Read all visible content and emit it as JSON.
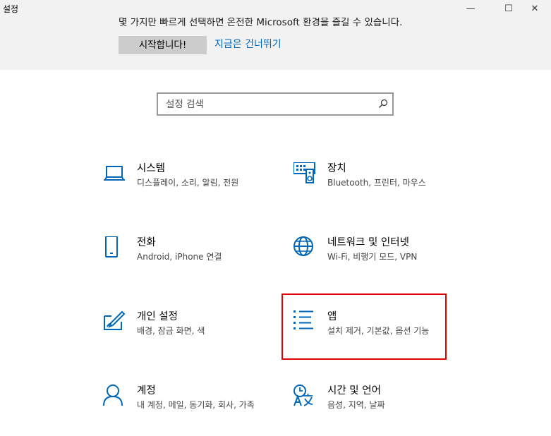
{
  "window": {
    "title": "설정",
    "minimize_glyph": "—",
    "maximize_glyph": "☐",
    "close_glyph": "✕"
  },
  "banner": {
    "text": "몇 가지만 빠르게 선택하면 온전한 Microsoft 환경을 즐길 수 있습니다.",
    "start_button": "시작합니다!",
    "skip_link": "지금은 건너뛰기"
  },
  "search": {
    "placeholder": "설정 검색"
  },
  "accent_color": "#0067b8",
  "highlight_color": "#e00000",
  "categories": [
    {
      "title": "시스템",
      "subtitle": "디스플레이, 소리, 알림, 전원",
      "icon": "laptop-icon"
    },
    {
      "title": "장치",
      "subtitle": "Bluetooth, 프린터, 마우스",
      "icon": "devices-icon"
    },
    {
      "title": "전화",
      "subtitle": "Android, iPhone 연결",
      "icon": "phone-icon"
    },
    {
      "title": "네트워크 및 인터넷",
      "subtitle": "Wi-Fi, 비행기 모드, VPN",
      "icon": "globe-icon"
    },
    {
      "title": "개인 설정",
      "subtitle": "배경, 잠금 화면, 색",
      "icon": "personalization-icon"
    },
    {
      "title": "앱",
      "subtitle": "설치 제거, 기본값, 옵션 기능",
      "icon": "apps-list-icon",
      "highlighted": true
    },
    {
      "title": "계정",
      "subtitle": "내 계정, 메일, 동기화, 회사, 가족",
      "icon": "person-icon"
    },
    {
      "title": "시간 및 언어",
      "subtitle": "음성, 지역, 날짜",
      "icon": "time-language-icon"
    }
  ]
}
